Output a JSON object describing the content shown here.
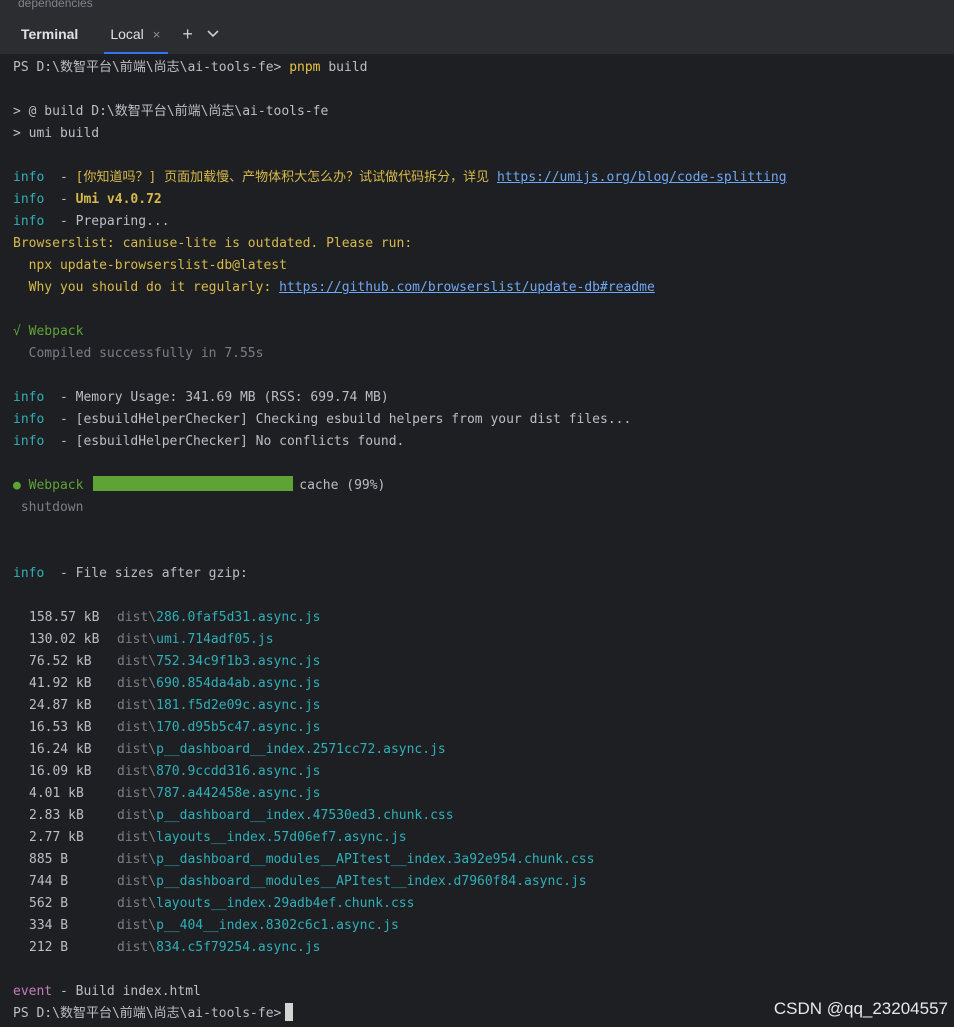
{
  "window": {
    "top_label": "dependencies"
  },
  "tabbar": {
    "title": "Terminal",
    "tab_label": "Local",
    "close": "×",
    "add": "+",
    "dropdown": "⌄"
  },
  "lines": {
    "prompt_path": "PS D:\\数智平台\\前端\\尚志\\ai-tools-fe>",
    "cmd_pnpm": "pnpm",
    "cmd_build": " build",
    "build_line": "> @ build D:\\数智平台\\前端\\尚志\\ai-tools-fe",
    "umi_build": "> umi build",
    "info": "info",
    "dash": "  - ",
    "tip_text": "[你知道吗？] 页面加载慢、产物体积大怎么办？试试做代码拆分，详见 ",
    "tip_link": "https://umijs.org/blog/code-splitting",
    "umi_version": "Umi v4.0.72",
    "preparing": "Preparing...",
    "browserslist": "Browserslist: caniuse-lite is outdated. Please run:",
    "npx": "  npx update-browserslist-db@latest",
    "why": "  Why you should do it regularly: ",
    "why_link": "https://github.com/browserslist/update-db#readme",
    "webpack_ok": "√ Webpack",
    "compiled": "  Compiled successfully in 7.55s",
    "memory": "Memory Usage: 341.69 MB (RSS: 699.74 MB)",
    "esbuild1": "[esbuildHelperChecker] Checking esbuild helpers from your dist files...",
    "esbuild2": "[esbuildHelperChecker] No conflicts found.",
    "webpack_progress_label": "● Webpack",
    "progress_status": "cache (99%)",
    "shutdown": " shutdown",
    "file_sizes": "File sizes after gzip:",
    "event": "event",
    "event_text": " - Build index.html"
  },
  "progress": {
    "percent": 99
  },
  "files": [
    {
      "size": "158.57 kB",
      "dir": "dist\\",
      "name": "286.0faf5d31.async.js"
    },
    {
      "size": "130.02 kB",
      "dir": "dist\\",
      "name": "umi.714adf05.js"
    },
    {
      "size": "76.52 kB",
      "dir": "dist\\",
      "name": "752.34c9f1b3.async.js"
    },
    {
      "size": "41.92 kB",
      "dir": "dist\\",
      "name": "690.854da4ab.async.js"
    },
    {
      "size": "24.87 kB",
      "dir": "dist\\",
      "name": "181.f5d2e09c.async.js"
    },
    {
      "size": "16.53 kB",
      "dir": "dist\\",
      "name": "170.d95b5c47.async.js"
    },
    {
      "size": "16.24 kB",
      "dir": "dist\\",
      "name": "p__dashboard__index.2571cc72.async.js"
    },
    {
      "size": "16.09 kB",
      "dir": "dist\\",
      "name": "870.9ccdd316.async.js"
    },
    {
      "size": "4.01 kB",
      "dir": "dist\\",
      "name": "787.a442458e.async.js"
    },
    {
      "size": "2.83 kB",
      "dir": "dist\\",
      "name": "p__dashboard__index.47530ed3.chunk.css"
    },
    {
      "size": "2.77 kB",
      "dir": "dist\\",
      "name": "layouts__index.57d06ef7.async.js"
    },
    {
      "size": "885 B",
      "dir": "dist\\",
      "name": "p__dashboard__modules__APItest__index.3a92e954.chunk.css"
    },
    {
      "size": "744 B",
      "dir": "dist\\",
      "name": "p__dashboard__modules__APItest__index.d7960f84.async.js"
    },
    {
      "size": "562 B",
      "dir": "dist\\",
      "name": "layouts__index.29adb4ef.chunk.css"
    },
    {
      "size": "334 B",
      "dir": "dist\\",
      "name": "p__404__index.8302c6c1.async.js"
    },
    {
      "size": "212 B",
      "dir": "dist\\",
      "name": "834.c5f79254.async.js"
    }
  ],
  "watermark": "CSDN @qq_23204557",
  "colors": {
    "background": "#1e1f22",
    "info": "#2fb0b8",
    "warning": "#d7ba4a",
    "success": "#5ea336",
    "link": "#6fa8f4",
    "accent": "#3574f0"
  }
}
